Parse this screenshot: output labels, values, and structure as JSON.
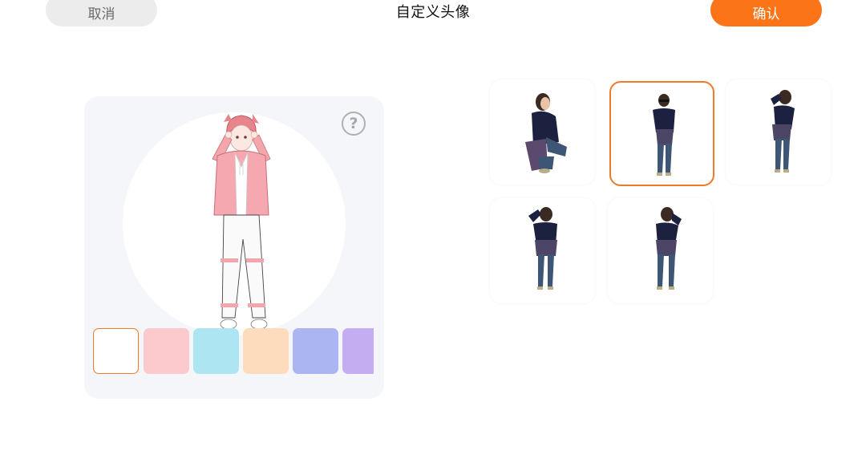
{
  "header": {
    "cancel_label": "取消",
    "title": "自定义头像",
    "confirm_label": "确认"
  },
  "preview": {
    "help_symbol": "?",
    "swatches": [
      {
        "color": "#ffffff",
        "selected": true
      },
      {
        "color": "#fccacd",
        "selected": false
      },
      {
        "color": "#ade5f2",
        "selected": false
      },
      {
        "color": "#fcdcbd",
        "selected": false
      },
      {
        "color": "#aab5f2",
        "selected": false
      },
      {
        "color": "#c4adf0",
        "selected": false
      }
    ]
  },
  "poses": [
    {
      "name": "crouch",
      "selected": false
    },
    {
      "name": "glasses",
      "selected": true
    },
    {
      "name": "salute",
      "selected": false
    },
    {
      "name": "salute-front",
      "selected": false
    },
    {
      "name": "hand-on-head",
      "selected": false
    }
  ],
  "colors": {
    "accent": "#fb7518",
    "panel_bg": "#f5f6fa",
    "cancel_bg": "#ececec"
  }
}
